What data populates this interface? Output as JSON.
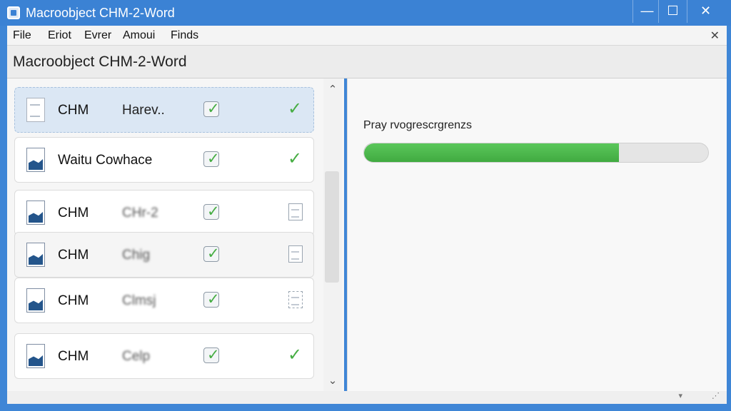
{
  "window": {
    "title": "Macroobject CHM-2-Word",
    "controls": [
      "minimize",
      "maximize",
      "close"
    ],
    "accent_color": "#3b82d4"
  },
  "menu": {
    "items": [
      "File",
      "Eriot",
      "Evrer",
      "Amoui",
      "Finds"
    ]
  },
  "header": {
    "title": "Macroobject CHM-2-Word"
  },
  "file_list": {
    "rows": [
      {
        "col1": "CHM",
        "col2": "Harev..",
        "checked": true,
        "status": "complete",
        "icon": "document-icon"
      },
      {
        "col1": "Waitu Cowhace",
        "col2": "",
        "checked": true,
        "status": "complete",
        "icon": "chm-file-icon"
      },
      {
        "col1": "CHM",
        "col2": "CHr-2",
        "checked": true,
        "status": "pending",
        "icon": "chm-file-icon"
      },
      {
        "col1": "CHM",
        "col2": "Chig",
        "checked": true,
        "status": "pending",
        "icon": "chm-file-icon"
      },
      {
        "col1": "CHM",
        "col2": "Clmsj",
        "checked": true,
        "status": "dashed",
        "icon": "chm-file-icon"
      },
      {
        "col1": "CHM",
        "col2": "Celp",
        "checked": true,
        "status": "complete",
        "icon": "chm-file-icon"
      }
    ]
  },
  "progress": {
    "label": "Pray rvogrescrgrenzs",
    "percent": 74,
    "fill_color": "#46ad43"
  }
}
